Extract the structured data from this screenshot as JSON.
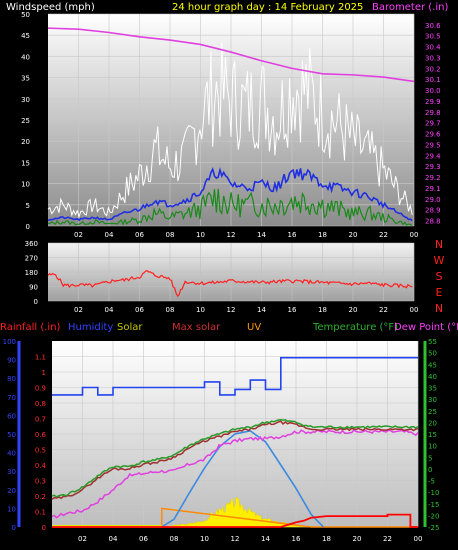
{
  "header": {
    "windspeed_label": "Windspeed (mph)",
    "title": "24 hour graph day : 14 February 2025",
    "barometer_label": "Barometer (.in)"
  },
  "colors": {
    "background": "#000000",
    "wind_avg": "#2030e0",
    "wind_gust": "#ffffff",
    "wind_lull": "#1a8a1a",
    "barometer": "#e040e0",
    "direction": "#ff2020",
    "humidity": "#2244ee",
    "solar": "#ffee00",
    "uv": "#ff8800",
    "max_solar": "#3a8ae0",
    "rainfall": "#ff0000",
    "temperature": "#2a9a2a",
    "dew_point": "#e040e0",
    "feels": "#a03030"
  },
  "chart_data": [
    {
      "type": "line",
      "title": "24 hour graph day : 14 February 2025",
      "x_ticks": [
        "02",
        "04",
        "06",
        "08",
        "10",
        "12",
        "14",
        "16",
        "18",
        "20",
        "22",
        "00"
      ],
      "x_hours": [
        0,
        24
      ],
      "left_axis": {
        "label": "Windspeed (mph)",
        "ylim": [
          0,
          50
        ],
        "ticks": [
          0,
          5,
          10,
          15,
          20,
          25,
          30,
          35,
          40,
          45,
          50
        ]
      },
      "right_axis": {
        "label": "Barometer (.in)",
        "ylim": [
          28.75,
          30.7
        ],
        "ticks": [
          28.8,
          28.9,
          29.0,
          29.1,
          29.2,
          29.3,
          29.4,
          29.5,
          29.6,
          29.7,
          29.8,
          29.9,
          30.0,
          30.1,
          30.2,
          30.3,
          30.4,
          30.5,
          30.6
        ]
      },
      "series": [
        {
          "name": "Barometer",
          "x": [
            0,
            2,
            4,
            6,
            8,
            10,
            12,
            14,
            16,
            18,
            20,
            22,
            24
          ],
          "values": [
            30.57,
            30.56,
            30.53,
            30.49,
            30.46,
            30.42,
            30.35,
            30.27,
            30.2,
            30.15,
            30.14,
            30.12,
            30.08
          ]
        },
        {
          "name": "Gust",
          "x": [
            0,
            1,
            2,
            3,
            4,
            5,
            6,
            7,
            8,
            9,
            10,
            11,
            12,
            13,
            14,
            15,
            16,
            17,
            18,
            19,
            20,
            21,
            22,
            23,
            24
          ],
          "values": [
            4,
            5,
            3,
            5,
            3,
            8,
            12,
            18,
            14,
            16,
            26,
            32,
            30,
            28,
            30,
            25,
            33,
            32,
            27,
            24,
            20,
            17,
            13,
            8,
            3
          ]
        },
        {
          "name": "Average",
          "x": [
            0,
            1,
            2,
            3,
            4,
            5,
            6,
            7,
            8,
            9,
            10,
            11,
            12,
            13,
            14,
            15,
            16,
            17,
            18,
            19,
            20,
            21,
            22,
            23,
            24
          ],
          "values": [
            1.5,
            2,
            1.5,
            2,
            1.5,
            3,
            4,
            6,
            5,
            6,
            8,
            13,
            10,
            9,
            10,
            9,
            13,
            12,
            10,
            9,
            8,
            7,
            5,
            3,
            1
          ]
        },
        {
          "name": "Lull",
          "x": [
            0,
            1,
            2,
            3,
            4,
            5,
            6,
            7,
            8,
            9,
            10,
            11,
            12,
            13,
            14,
            15,
            16,
            17,
            18,
            19,
            20,
            21,
            22,
            23,
            24
          ],
          "values": [
            0.5,
            1,
            0.5,
            1,
            0.5,
            1,
            1.5,
            3,
            2,
            3,
            4,
            7,
            5,
            5,
            5,
            5,
            6,
            6,
            5,
            4,
            3,
            3,
            2,
            1,
            0
          ]
        }
      ]
    },
    {
      "type": "line",
      "x_ticks": [
        "02",
        "04",
        "06",
        "08",
        "10",
        "12",
        "14",
        "16",
        "18",
        "20",
        "22",
        "00"
      ],
      "ylim": [
        0,
        360
      ],
      "y_ticks": [
        0,
        90,
        180,
        270,
        360
      ],
      "right_labels": [
        "N",
        "W",
        "S",
        "E",
        "N"
      ],
      "series": [
        {
          "name": "Direction",
          "x": [
            0,
            0.5,
            1,
            1.5,
            2,
            3,
            4,
            4.5,
            5,
            6,
            6.5,
            7,
            8,
            8.5,
            9,
            10,
            11,
            12,
            13,
            14,
            15,
            16,
            17,
            18,
            19,
            20,
            21,
            22,
            23,
            24
          ],
          "values": [
            160,
            165,
            100,
            95,
            100,
            95,
            120,
            130,
            130,
            150,
            185,
            160,
            140,
            30,
            120,
            110,
            115,
            125,
            120,
            115,
            120,
            125,
            120,
            115,
            110,
            105,
            110,
            100,
            95,
            90
          ]
        }
      ]
    },
    {
      "type": "line",
      "x_ticks": [
        "02",
        "04",
        "06",
        "08",
        "10",
        "12",
        "14",
        "16",
        "18",
        "20",
        "22",
        "00"
      ],
      "legend": [
        "Rainfall (.in)",
        "Humidity",
        "Solar",
        "Max solar",
        "UV",
        "Temperature (°F)",
        "Dew Point (°F)"
      ],
      "axis_rainfall": {
        "ylim": [
          0,
          1.2
        ],
        "ticks": [
          0,
          0.1,
          0.2,
          0.3,
          0.4,
          0.5,
          0.6,
          0.7,
          0.8,
          0.9,
          1,
          1.1
        ]
      },
      "axis_humidity": {
        "ylim": [
          0,
          100
        ],
        "ticks": [
          0,
          10,
          20,
          30,
          40,
          50,
          60,
          70,
          80,
          90,
          100
        ]
      },
      "axis_temperature": {
        "ylim": [
          -25,
          55
        ],
        "ticks": [
          -25,
          -20,
          -15,
          -10,
          -5,
          0,
          5,
          10,
          15,
          20,
          25,
          30,
          35,
          40,
          45,
          50,
          55
        ]
      },
      "series": [
        {
          "name": "Humidity",
          "x": [
            0,
            2,
            2,
            3,
            3,
            4,
            4,
            7,
            7,
            10,
            10,
            11,
            11,
            12,
            12,
            13,
            13,
            14,
            14,
            15,
            15,
            24
          ],
          "values": [
            71,
            71,
            75,
            75,
            71,
            71,
            75,
            75,
            75,
            75,
            78,
            78,
            71,
            71,
            74,
            74,
            79,
            79,
            74,
            74,
            91,
            91
          ]
        },
        {
          "name": "Temperature",
          "x": [
            0,
            1,
            2,
            3,
            4,
            5,
            6,
            7,
            8,
            9,
            10,
            11,
            12,
            13,
            14,
            15,
            16,
            17,
            18,
            19,
            20,
            21,
            22,
            23,
            24
          ],
          "values": [
            -12,
            -11,
            -8,
            -3,
            1,
            1,
            3,
            4,
            6,
            10,
            13,
            15,
            17,
            18,
            20,
            21,
            20,
            18,
            18,
            18,
            18,
            18,
            18,
            18,
            18
          ]
        },
        {
          "name": "Feels",
          "x": [
            0,
            1,
            2,
            3,
            4,
            5,
            6,
            7,
            8,
            9,
            10,
            11,
            12,
            13,
            14,
            15,
            16,
            17,
            18,
            19,
            20,
            21,
            22,
            23,
            24
          ],
          "values": [
            -13,
            -12,
            -9,
            -4,
            0,
            0,
            2,
            3,
            5,
            9,
            12,
            14,
            16,
            17,
            19,
            20,
            19,
            17,
            17,
            17,
            17,
            17,
            17,
            17,
            17
          ]
        },
        {
          "name": "Dew Point",
          "x": [
            0,
            1,
            2,
            3,
            4,
            5,
            6,
            7,
            8,
            9,
            10,
            11,
            12,
            13,
            14,
            15,
            16,
            17,
            18,
            19,
            20,
            21,
            22,
            23,
            24
          ],
          "values": [
            -21,
            -19,
            -18,
            -14,
            -9,
            -3,
            -2,
            -1,
            -1,
            2,
            4,
            10,
            12,
            13,
            13,
            14,
            16,
            16,
            16,
            16,
            16,
            16,
            16,
            16,
            15
          ]
        },
        {
          "name": "Max solar",
          "x": [
            7.2,
            8,
            9,
            10,
            11,
            12,
            13,
            14,
            15,
            16,
            17,
            17.8
          ],
          "values": [
            0,
            0.05,
            0.22,
            0.38,
            0.52,
            0.6,
            0.62,
            0.55,
            0.4,
            0.25,
            0.08,
            0
          ]
        },
        {
          "name": "Solar",
          "x": [
            7.2,
            8,
            9,
            10,
            10.5,
            11,
            11.5,
            12,
            12.5,
            13,
            13.5,
            14,
            15,
            16,
            17
          ],
          "values": [
            0,
            0.01,
            0.02,
            0.04,
            0.08,
            0.11,
            0.13,
            0.16,
            0.14,
            0.1,
            0.07,
            0.05,
            0.03,
            0.01,
            0
          ]
        },
        {
          "name": "UV",
          "x": [
            0,
            7.2,
            7.2,
            17,
            24
          ],
          "values": [
            0,
            0,
            0.12,
            0,
            0
          ]
        },
        {
          "name": "Rainfall",
          "x": [
            0,
            15,
            16,
            16.5,
            17,
            18,
            22,
            22,
            23.5,
            23.5,
            24
          ],
          "values": [
            0,
            0,
            0.03,
            0.04,
            0.06,
            0.07,
            0.07,
            0.08,
            0.08,
            0,
            0
          ]
        }
      ]
    }
  ]
}
